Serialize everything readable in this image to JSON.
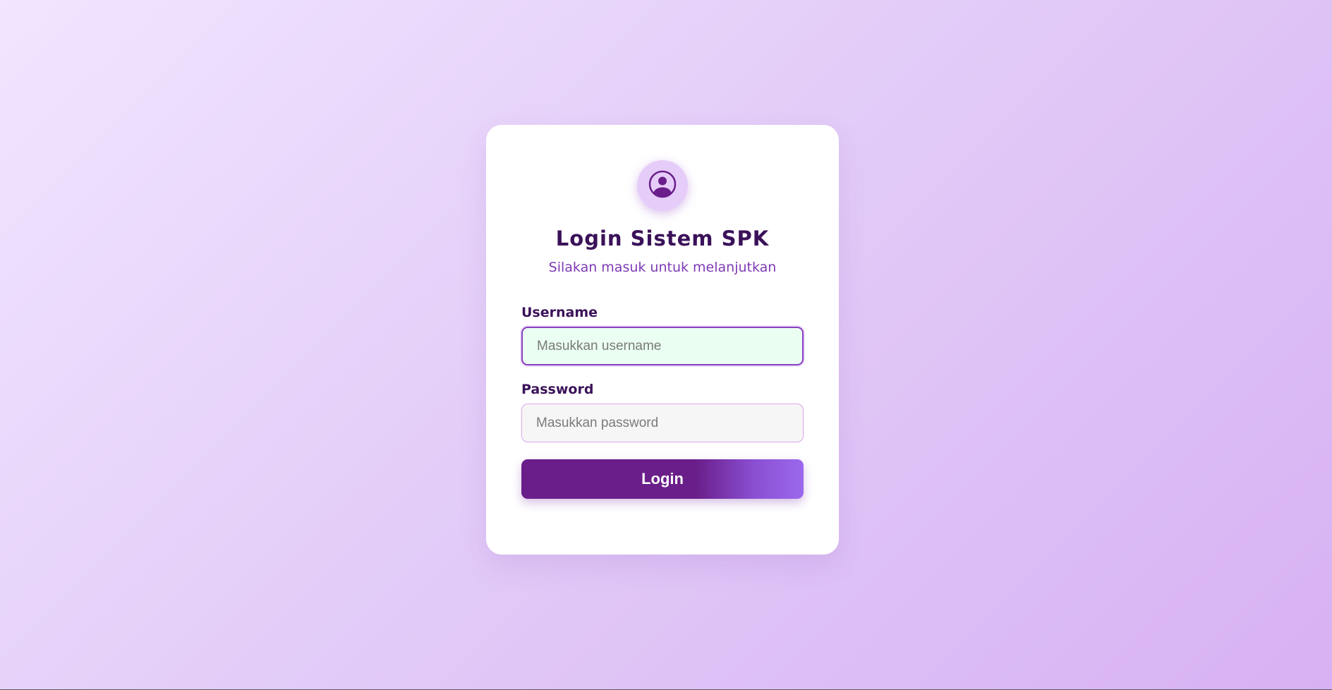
{
  "login": {
    "title": "Login Sistem SPK",
    "subtitle": "Silakan masuk untuk melanjutkan",
    "username_label": "Username",
    "username_placeholder": "Masukkan username",
    "username_value": "",
    "password_label": "Password",
    "password_placeholder": "Masukkan password",
    "password_value": "",
    "button_label": "Login",
    "avatar_icon": "user-circle-icon"
  },
  "colors": {
    "primary": "#6a1e8a",
    "title": "#3b1259",
    "subtitle": "#7e3ab5",
    "accent_gradient_end": "#9b69ee",
    "username_field_bg": "#eafff1"
  }
}
